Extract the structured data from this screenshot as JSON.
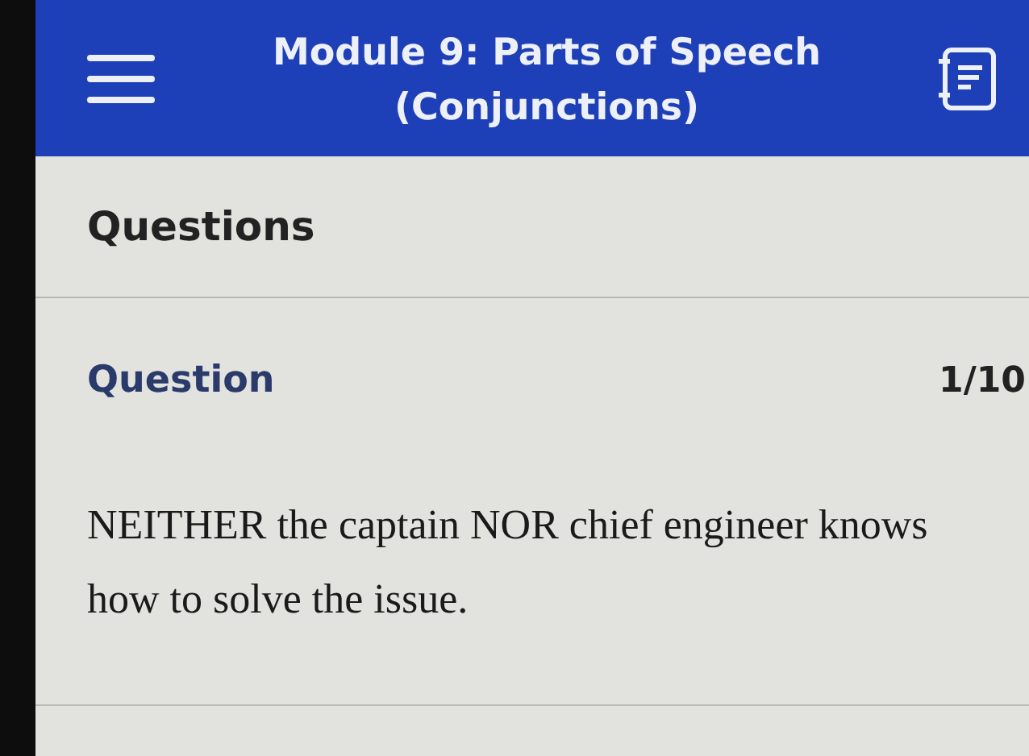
{
  "header": {
    "title": "Module 9: Parts of Speech (Conjunctions)"
  },
  "section_title": "Questions",
  "question": {
    "label": "Question",
    "counter": "1/10",
    "text": "NEITHER the captain NOR chief engineer knows how to solve the issue."
  }
}
